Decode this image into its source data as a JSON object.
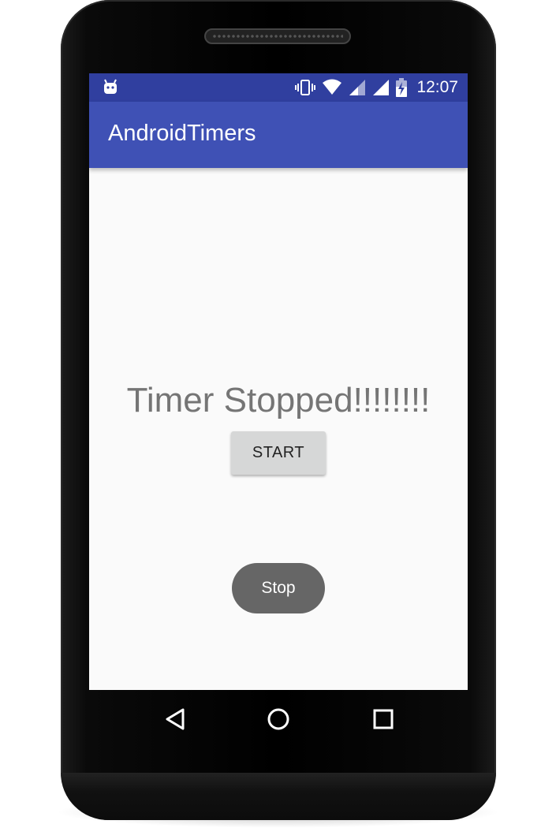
{
  "status_bar": {
    "time": "12:07",
    "icons": [
      "android-debug-icon",
      "vibrate-icon",
      "wifi-icon",
      "signal-icon",
      "signal-icon",
      "battery-charging-icon"
    ]
  },
  "app_bar": {
    "title": "AndroidTimers"
  },
  "main": {
    "timer_text": "Timer Stopped!!!!!!!!",
    "start_button_label": "START",
    "stop_button_label": "Stop"
  },
  "nav_bar": {
    "icons": [
      "back-icon",
      "home-icon",
      "recent-apps-icon"
    ]
  },
  "colors": {
    "status_bar": "#303f9f",
    "app_bar": "#3f51b5",
    "screen_background": "#fafafa",
    "timer_text": "#757575",
    "start_button": "#d6d7d7",
    "stop_button": "#666666"
  }
}
